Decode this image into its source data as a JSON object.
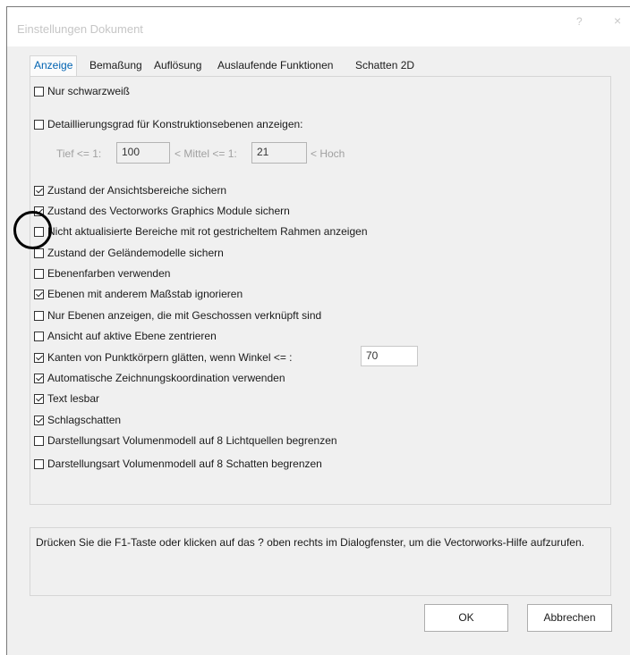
{
  "window": {
    "title": "Einstellungen Dokument",
    "help": "?",
    "close": "×"
  },
  "tabs": [
    "Anzeige",
    "Bemaßung",
    "Auflösung",
    "Auslaufende Funktionen",
    "Schatten 2D"
  ],
  "options": [
    {
      "label": "Nur schwarzweiß",
      "checked": false
    },
    {
      "label": "Detaillierungsgrad für Konstruktionsebenen anzeigen:",
      "checked": false
    },
    {
      "label": "Zustand der Ansichtsbereiche sichern",
      "checked": true
    },
    {
      "label": "Zustand des Vectorworks Graphics Module sichern",
      "checked": true
    },
    {
      "label": "Nicht aktualisierte Bereiche mit rot gestricheltem Rahmen anzeigen",
      "checked": false
    },
    {
      "label": "Zustand der Geländemodelle sichern",
      "checked": false
    },
    {
      "label": "Ebenenfarben verwenden",
      "checked": false
    },
    {
      "label": "Ebenen mit anderem Maßstab ignorieren",
      "checked": true
    },
    {
      "label": "Nur Ebenen anzeigen, die mit Geschossen verknüpft sind",
      "checked": false
    },
    {
      "label": "Ansicht auf aktive Ebene zentrieren",
      "checked": false
    },
    {
      "label": "Kanten von Punktkörpern glätten, wenn Winkel <= :",
      "checked": true
    },
    {
      "label": "Automatische Zeichnungskoordination verwenden",
      "checked": true
    },
    {
      "label": "Text lesbar",
      "checked": true
    },
    {
      "label": "Schlagschatten",
      "checked": true
    },
    {
      "label": "Darstellungsart Volumenmodell auf 8 Lichtquellen begrenzen",
      "checked": false
    },
    {
      "label": "Darstellungsart Volumenmodell auf 8 Schatten begrenzen",
      "checked": false
    }
  ],
  "detail": {
    "tief_label": "Tief <= 1:",
    "tief_value": "100",
    "mittel_label": "< Mittel <= 1:",
    "mittel_value": "21",
    "hoch_label": "< Hoch"
  },
  "angle_value": "70",
  "help_text": "Drücken Sie die F1-Taste oder klicken auf das ? oben rechts im Dialogfenster, um die Vectorworks-Hilfe aufzurufen.",
  "buttons": {
    "ok": "OK",
    "cancel": "Abbrechen"
  }
}
